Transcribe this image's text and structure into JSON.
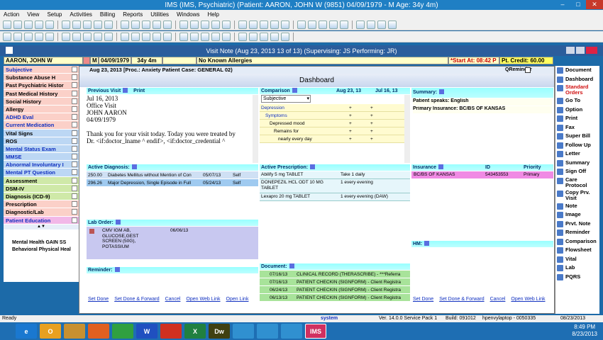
{
  "window": {
    "title": "IMS (IMS, Psychiatric)    (Patient: AARON, JOHN W (9851) 04/09/1979 - M Age: 34y 4m)"
  },
  "menu": [
    "Action",
    "View",
    "Setup",
    "Activities",
    "Billing",
    "Reports",
    "Utilities",
    "Windows",
    "Help"
  ],
  "visit": {
    "title": "Visit Note (Aug 23, 2013    13 of 13) (Supervising: JS Performing: JR)"
  },
  "patient": {
    "name": "AARON, JOHN W",
    "sex": "M",
    "dob": "04/09/1979",
    "age": "34y 4m",
    "allergies": "No Known Allergies",
    "start": "*Start At: 08:42 P",
    "credit": "Pt. Credit: 60.00"
  },
  "left_nav": [
    {
      "label": "Subjective",
      "c": "pink",
      "blue": true
    },
    {
      "label": "Substance Abuse H",
      "c": "pink"
    },
    {
      "label": "Past Psychiatric Histor",
      "c": "pink"
    },
    {
      "label": "Past Medical History",
      "c": "pink"
    },
    {
      "label": "Social History",
      "c": "pink"
    },
    {
      "label": "Allergy",
      "c": "pink"
    },
    {
      "label": "ADHD Eval",
      "c": "pink",
      "blue": true
    },
    {
      "label": "Current Medication",
      "c": "pink",
      "blue": true
    },
    {
      "label": "Vital Signs",
      "c": "blu"
    },
    {
      "label": "ROS",
      "c": "blu"
    },
    {
      "label": "Mental Status Exam",
      "c": "blu",
      "blue": true
    },
    {
      "label": "MMSE",
      "c": "blu",
      "blue": true
    },
    {
      "label": "Abnormal Involuntary I",
      "c": "blu",
      "blue": true
    },
    {
      "label": "Mental PT Question",
      "c": "blu",
      "blue": true
    },
    {
      "label": "Assessment",
      "c": "grn"
    },
    {
      "label": "DSM-IV",
      "c": "grn"
    },
    {
      "label": "Diagnosis (ICD-9)",
      "c": "grn"
    },
    {
      "label": "Prescription",
      "c": "pink"
    },
    {
      "label": "Diagnostic/Lab",
      "c": "pink"
    },
    {
      "label": "Patient Education",
      "c": "mag",
      "blue": true
    }
  ],
  "left_bottom": [
    "Mental Health GAIN SS",
    "Behavioral Physical Heal"
  ],
  "dash": {
    "header": "Aug 23, 2013  [Proc.: Anxiety Patient  Case: GENERAL 02)",
    "qreminder": "QReminder",
    "title": "Dashboard",
    "prev_visit": "Previous Visit",
    "print": "Print",
    "letter": [
      "Jul 16, 2013",
      "Office Visit",
      "JOHN AARON",
      "04/09/1979",
      "",
      "Thank you for your visit today. Today you were treated by",
      "Dr. <if:doctor_lname ^ endif>, <if:doctor_credential ^"
    ],
    "comparison": "Comparison",
    "comp_dates": [
      "Aug 23, 13",
      "Jul 16, 13"
    ],
    "comp_select": "Subjective",
    "comp_rows": [
      [
        "Depression",
        "+",
        "+"
      ],
      [
        "Symptoms",
        "+",
        "+"
      ],
      [
        "Depressed mood",
        "+",
        "+"
      ],
      [
        "Remains for",
        "+",
        "+"
      ],
      [
        "nearly every day",
        "+",
        "+"
      ]
    ],
    "summary": "Summary:",
    "summary_lines": [
      "Patient speaks: English",
      "Primary Insurance: BC/BS OF KANSAS"
    ],
    "active_dx": "Active Diagnosis:",
    "dx_rows": [
      [
        "250.00",
        "Diabetes Mellitus without Mention of Con",
        "05/07/13",
        "Self"
      ],
      [
        "296.26",
        "Major Depression, Single Episode in Full",
        "05/24/13",
        "Self"
      ]
    ],
    "active_rx": "Active Prescription:",
    "rx_rows": [
      [
        "Abilify 5 mg TABLET",
        "Take 1 daily"
      ],
      [
        "DONEPEZIL HCL ODT 10 MG TABLET",
        "1 every evening"
      ],
      [
        "Lexapro 20 mg TABLET",
        "1 every evening (DAW)"
      ]
    ],
    "insurance": "Insurance",
    "ins_id": "ID",
    "ins_pri": "Priority",
    "ins_row": [
      "BC/BS OF KANSAS",
      "543453553",
      "Primary"
    ],
    "lab": "Lab Order:",
    "lab_row": [
      "CMV IGM AB, GLUCOSE,GEST SCREEN (50G), POTASSIUM",
      "06/06/13"
    ],
    "hm": "HM:",
    "reminder": "Reminder:",
    "document": "Document:",
    "doc_rows": [
      [
        "07/16/13",
        "CLINICAL RECORD (THERASCRIBE) - ***Referra"
      ],
      [
        "07/16/13",
        "PATIENT CHECKIN (SIGNFORM) - Client Registra"
      ],
      [
        "06/24/13",
        "PATIENT CHECKIN (SIGNFORM) - Client Registra"
      ],
      [
        "06/13/13",
        "PATIENT CHECKIN (SIGNFORM) - Client Registra"
      ]
    ],
    "links": [
      "Set Done",
      "Set Done & Forward",
      "Cancel",
      "Open Web Link"
    ],
    "links2": "Open Link"
  },
  "right_nav": [
    "Document",
    "Dashboard",
    "Standard Orders",
    "Go To",
    "Option",
    "Print",
    "Fax",
    "Super Bill",
    "Follow Up",
    "Letter",
    "Summary",
    "Sign Off",
    "Care Protocol",
    "Copy Prv. Visit",
    "Note",
    "Image",
    "Prvt. Note",
    "Reminder",
    "Comparison",
    "Flowsheet",
    "Vital",
    "Lab",
    "PQRS"
  ],
  "status": {
    "left": "Ready",
    "user": "system",
    "ver": "Ver. 14.0.0 Service Pack 1",
    "build": "Build: 091012",
    "host": "hpenvylaptop - 0050335",
    "date": "08/23/2013"
  },
  "clock": {
    "time": "8:49 PM",
    "date": "8/23/2013"
  },
  "taskbar": [
    "e",
    "O",
    "",
    "",
    "",
    "W",
    "",
    "X",
    "Dw",
    "",
    "",
    "",
    "IMS"
  ]
}
